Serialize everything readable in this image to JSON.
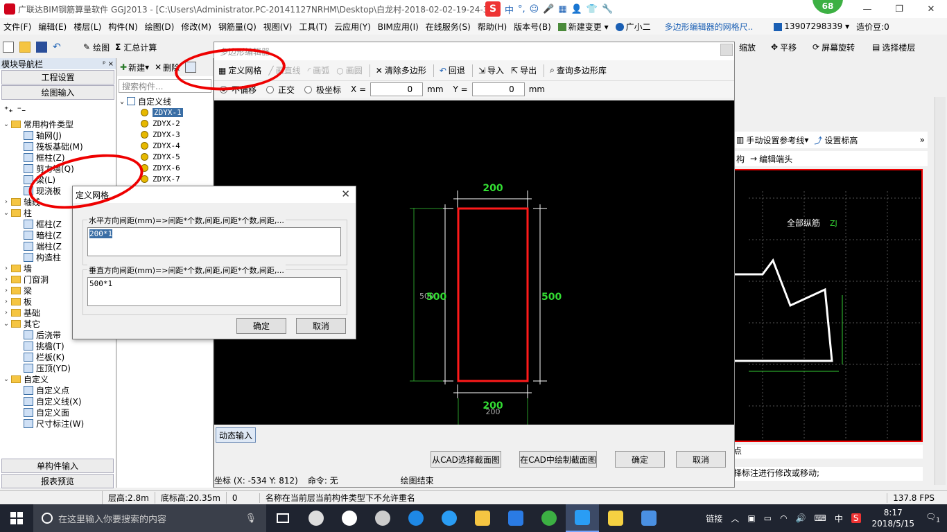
{
  "window": {
    "title": "广联达BIM钢筋算量软件 GGJ2013 - [C:\\Users\\Administrator.PC-20141127NRHM\\Desktop\\白龙村-2018-02-02-19-24-35",
    "ime_items": [
      "中",
      "°,",
      "☺",
      "🎤",
      "▦",
      "👤",
      "👕",
      "🔧"
    ],
    "score": "68",
    "controls": [
      "—",
      "❐",
      "✕"
    ]
  },
  "menubar": {
    "items": [
      "文件(F)",
      "编辑(E)",
      "楼层(L)",
      "构件(N)",
      "绘图(D)",
      "修改(M)",
      "钢筋量(Q)",
      "视图(V)",
      "工具(T)",
      "云应用(Y)",
      "BIM应用(I)",
      "在线服务(S)",
      "帮助(H)",
      "版本号(B)"
    ],
    "new_change": "新建变更",
    "assistant": "广小二",
    "help_text": "多边形编辑器的网格尺..",
    "phone": "13907298339",
    "cost_beans": "造价豆:0"
  },
  "toolbar": {
    "draw": "绘图",
    "sum": "汇总计算",
    "zoom": "缩放",
    "pan": "平移",
    "rotate": "屏幕旋转",
    "select_floor": "选择楼层"
  },
  "sidebar": {
    "header": "模块导航栏",
    "pin": "ᵖ ×",
    "tab_project": "工程设置",
    "tab_draw": "绘图输入",
    "tree": [
      {
        "label": "常用构件类型",
        "type": "folder",
        "level": 0,
        "open": true
      },
      {
        "label": "轴网(J)",
        "type": "item",
        "level": 1
      },
      {
        "label": "筏板基础(M)",
        "type": "item",
        "level": 1
      },
      {
        "label": "框柱(Z)",
        "type": "item",
        "level": 1
      },
      {
        "label": "剪力墙(Q)",
        "type": "item",
        "level": 1
      },
      {
        "label": "梁(L)",
        "type": "item",
        "level": 1
      },
      {
        "label": "现浇板",
        "type": "item",
        "level": 1
      },
      {
        "label": "轴线",
        "type": "folder",
        "level": 0,
        "open": false
      },
      {
        "label": "柱",
        "type": "folder",
        "level": 0,
        "open": true
      },
      {
        "label": "框柱(Z",
        "type": "item",
        "level": 1
      },
      {
        "label": "暗柱(Z",
        "type": "item",
        "level": 1
      },
      {
        "label": "端柱(Z",
        "type": "item",
        "level": 1
      },
      {
        "label": "构造柱",
        "type": "item",
        "level": 1
      },
      {
        "label": "墙",
        "type": "folder",
        "level": 0,
        "open": false
      },
      {
        "label": "门窗洞",
        "type": "folder",
        "level": 0,
        "open": false
      },
      {
        "label": "梁",
        "type": "folder",
        "level": 0,
        "open": false
      },
      {
        "label": "板",
        "type": "folder",
        "level": 0,
        "open": false
      },
      {
        "label": "基础",
        "type": "folder",
        "level": 0,
        "open": false
      },
      {
        "label": "其它",
        "type": "folder",
        "level": 0,
        "open": true
      },
      {
        "label": "后浇带",
        "type": "item",
        "level": 1
      },
      {
        "label": "挑檐(T)",
        "type": "item",
        "level": 1
      },
      {
        "label": "栏板(K)",
        "type": "item",
        "level": 1
      },
      {
        "label": "压顶(YD)",
        "type": "item",
        "level": 1
      },
      {
        "label": "自定义",
        "type": "folder",
        "level": 0,
        "open": true
      },
      {
        "label": "自定义点",
        "type": "item",
        "level": 1
      },
      {
        "label": "自定义线(X)",
        "type": "item",
        "level": 1
      },
      {
        "label": "自定义面",
        "type": "item",
        "level": 1
      },
      {
        "label": "尺寸标注(W)",
        "type": "item",
        "level": 1
      }
    ],
    "tab_single": "单构件输入",
    "tab_report": "报表预览"
  },
  "components": {
    "new_btn": "新建",
    "delete_btn": "删除",
    "search_placeholder": "搜索构件...",
    "root": "自定义线",
    "items": [
      "ZDYX-1",
      "ZDYX-2",
      "ZDYX-3",
      "ZDYX-4",
      "ZDYX-5",
      "ZDYX-6",
      "ZDYX-7"
    ],
    "selected": "ZDYX-1"
  },
  "poly_editor": {
    "title": "多边形编辑器",
    "toolbar": {
      "define_grid": "定义网格",
      "draw_line": "画直线",
      "draw_arc": "画弧",
      "draw_circle": "画圆",
      "clear_polygon": "清除多边形",
      "undo": "回退",
      "import": "导入",
      "export": "导出",
      "query_lib": "查询多边形库"
    },
    "options": {
      "no_offset": "不偏移",
      "ortho": "正交",
      "polar": "极坐标",
      "x_label": "X =",
      "x_value": "0",
      "y_label": "Y =",
      "y_value": "0",
      "unit": "mm"
    },
    "canvas": {
      "dim_top": "200",
      "dim_bottom": "200",
      "dim_bottom_gray": "200",
      "dim_left": "500",
      "dim_left_gray": "500",
      "dim_right": "500"
    },
    "dynamic_input": "动态输入",
    "btn_cad_select": "从CAD选择截面图",
    "btn_cad_draw": "在CAD中绘制截面图",
    "btn_ok": "确定",
    "btn_cancel": "取消",
    "status_coord": "坐标 (X: -534 Y: 812)",
    "status_cmd": "命令: 无",
    "status_msg": "绘图结束"
  },
  "grid_dialog": {
    "title": "定义网格",
    "h_label": "水平方向间距(mm)=>间距*个数,间距,间距*个数,间距,...",
    "h_value": "200*1",
    "v_label": "垂直方向间距(mm)=>间距*个数,间距,间距*个数,间距,...",
    "v_value": "500*1",
    "ok": "确定",
    "cancel": "取消"
  },
  "right_panel": {
    "manual_ref": "手动设置参考线",
    "set_elev": "设置标高",
    "struct": "构",
    "edit_end": "编辑端头",
    "all_rebar": "全部纵筋",
    "zj": "ZJ",
    "foot1": "点",
    "foot2": "择标注进行修改或移动;"
  },
  "app_status": {
    "floor_height": "层高:2.8m",
    "bottom_elev": "底标高:20.35m",
    "zero": "0",
    "message": "名称在当前层当前构件类型下不允许重名",
    "fps": "137.8 FPS"
  },
  "taskbar": {
    "search_placeholder": "在这里输入你要搜索的内容",
    "link": "链接",
    "ime": "中",
    "time": "8:17",
    "date": "2018/5/15",
    "notif": "1"
  },
  "colors": {
    "highlight_red": "#e00000",
    "dim_green": "#33dd33",
    "rect_red": "#ff1a1a",
    "canvas_bg": "#000000"
  }
}
